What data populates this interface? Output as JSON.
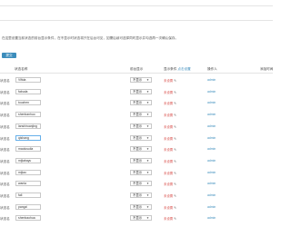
{
  "notice": "在这里设置当前状态的前台显示条件，在不显示时状态将只在后台可见，如需后续可选择同时显示并勾选再一次确认保存。",
  "toolbar": {
    "submit_label": "提交"
  },
  "table": {
    "headers": {
      "name": "状态名称",
      "visibility": "前台显示",
      "condition": "显示条件",
      "condition_link": "点击设置",
      "updater": "操作人",
      "extra": "添加时间"
    },
    "rows": [
      {
        "label": "状态名",
        "name": "Vifida",
        "visibility": "不显示",
        "condition": "未设置",
        "updater": "admin"
      },
      {
        "label": "状态名",
        "name": "fabuda",
        "visibility": "不显示",
        "condition": "未设置",
        "updater": "admin"
      },
      {
        "label": "状态名",
        "name": "touzhen",
        "visibility": "不显示",
        "condition": "未设置",
        "updater": "admin"
      },
      {
        "label": "状态名",
        "name": "shenbanhuo",
        "visibility": "不显示",
        "condition": "未设置",
        "updater": "admin"
      },
      {
        "label": "状态名",
        "name": "lanshiruanjing",
        "visibility": "不显示",
        "condition": "未设置",
        "updater": "admin"
      },
      {
        "label": "状态名",
        "name": "qishang",
        "visibility": "不显示",
        "condition": "未设置",
        "updater": "admin"
      },
      {
        "label": "状态名",
        "name": "maolusuila",
        "visibility": "不显示",
        "condition": "未设置",
        "updater": "admin"
      },
      {
        "label": "状态名",
        "name": "mijiabayu",
        "visibility": "不显示",
        "condition": "未设置",
        "updater": "admin"
      },
      {
        "label": "状态名",
        "name": "mijiao",
        "visibility": "不显示",
        "condition": "未设置",
        "updater": "admin"
      },
      {
        "label": "状态名",
        "name": "wanla",
        "visibility": "不显示",
        "condition": "未设置",
        "updater": "admin"
      },
      {
        "label": "状态名",
        "name": "fali",
        "visibility": "不显示",
        "condition": "未设置",
        "updater": "admin"
      },
      {
        "label": "状态名",
        "name": "pangzi",
        "visibility": "不显示",
        "condition": "未设置",
        "updater": "admin"
      },
      {
        "label": "状态名",
        "name": "shenbaohua",
        "visibility": "不显示",
        "condition": "未设置",
        "updater": "admin"
      }
    ]
  },
  "icons": {
    "edit": "pencil-icon",
    "dropdown": "chevron-down-icon"
  },
  "colors": {
    "accent": "#3c8dbc",
    "unset": "#d9534f",
    "border": "#c8c8c8"
  }
}
